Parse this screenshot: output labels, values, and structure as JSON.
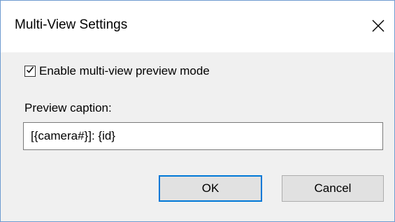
{
  "window": {
    "title": "Multi-View Settings",
    "close_icon": "close-icon"
  },
  "options": {
    "enable_multiview_label": "Enable multi-view preview mode",
    "enable_multiview_checked": true
  },
  "caption": {
    "label": "Preview caption:",
    "value": "[{camera#}]: {id}"
  },
  "buttons": {
    "ok_label": "OK",
    "cancel_label": "Cancel"
  },
  "colors": {
    "accent": "#0078d7",
    "dialog_background": "#f0f0f0",
    "titlebar_background": "#ffffff",
    "window_border": "#6e9bd0"
  }
}
